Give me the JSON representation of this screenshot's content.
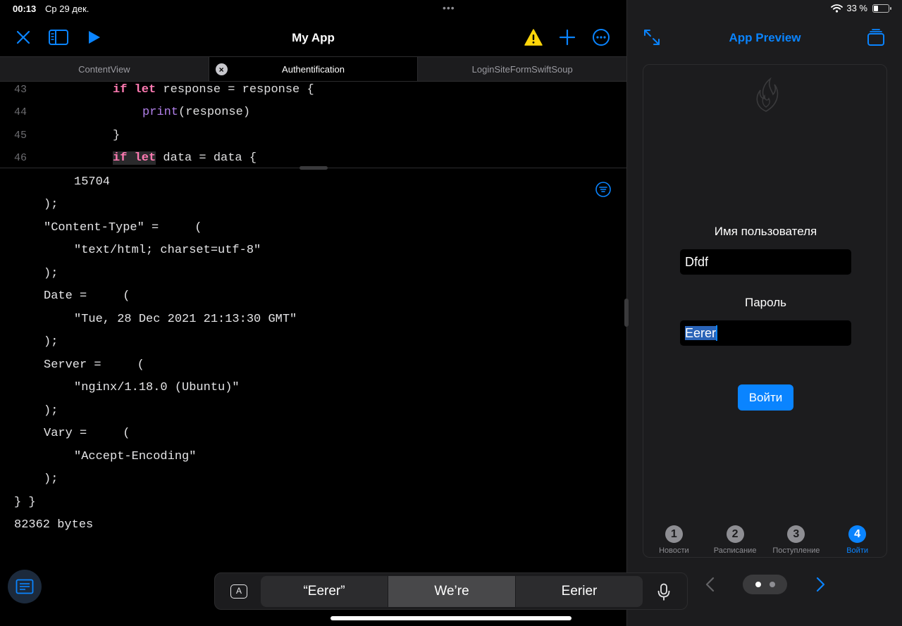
{
  "status": {
    "time": "00:13",
    "date": "Ср 29 дек.",
    "battery": "33 %",
    "battery_level": 0.33
  },
  "app": {
    "title": "My App"
  },
  "tabs": [
    {
      "label": "ContentView"
    },
    {
      "label": "Authentification"
    },
    {
      "label": "LoginSiteFormSwiftSoup"
    }
  ],
  "code": {
    "lines": [
      {
        "num": "43",
        "kw1": "if",
        "kw2": "let",
        "rest": " response = response {"
      },
      {
        "num": "44",
        "fn": "print",
        "rest": "(response)"
      },
      {
        "num": "45",
        "rest": "}"
      },
      {
        "num": "46",
        "kw1": "if",
        "kw2": "let",
        "rest": " data = data {"
      }
    ]
  },
  "console": {
    "lines": [
      "15704",
      ");",
      "\"Content-Type\" =     (",
      "\"text/html; charset=utf-8\"",
      ");",
      "Date =     (",
      "\"Tue, 28 Dec 2021 21:13:30 GMT\"",
      ");",
      "Server =     (",
      "\"nginx/1.18.0 (Ubuntu)\"",
      ");",
      "Vary =     (",
      "\"Accept-Encoding\"",
      ");",
      "} }",
      "82362 bytes"
    ]
  },
  "keyboard": {
    "suggestions": [
      "“Eerer”",
      "We’re",
      "Eerier"
    ],
    "a_label": "A"
  },
  "preview": {
    "title": "App Preview",
    "username_label": "Имя пользователя",
    "username_value": "Dfdf",
    "password_label": "Пароль",
    "password_value": "Eerer",
    "login_button": "Войти",
    "tabbar": [
      {
        "num": "1",
        "label": "Новости"
      },
      {
        "num": "2",
        "label": "Расписание"
      },
      {
        "num": "3",
        "label": "Поступление"
      },
      {
        "num": "4",
        "label": "Войти"
      }
    ]
  },
  "icons": {
    "close": "close-icon",
    "sidebar": "sidebar-icon",
    "run": "play-icon",
    "warning": "warning-icon",
    "add": "plus-icon",
    "more": "ellipsis-icon",
    "expand": "expand-icon",
    "windows": "windows-icon"
  },
  "colors": {
    "accent": "#0a84ff",
    "keyword": "#ff7ab2",
    "function": "#b281eb",
    "warning": "#ffd60a"
  }
}
